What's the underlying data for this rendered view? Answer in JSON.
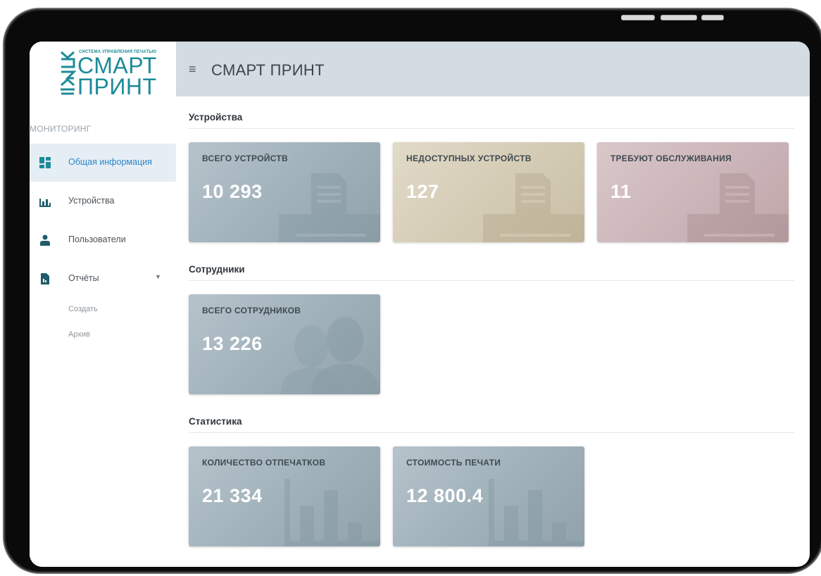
{
  "app": {
    "logo_tagline": "СИСТЕМА УПРАВЛЕНИЯ ПЕЧАТЬЮ",
    "logo_line1": "СМАРТ",
    "logo_line2": "ПРИНТ",
    "header_title": "СМАРТ ПРИНТ",
    "brand_color": "#1d8b98"
  },
  "sidebar": {
    "section_label": "МОНИТОРИНГ",
    "items": [
      {
        "label": "Общая информация",
        "icon": "dashboard-icon",
        "active": true
      },
      {
        "label": "Устройства",
        "icon": "bar-chart-icon",
        "active": false
      },
      {
        "label": "Пользователи",
        "icon": "user-icon",
        "active": false
      },
      {
        "label": "Отчёты",
        "icon": "document-icon",
        "active": false,
        "expandable": true
      }
    ],
    "sub_items": [
      {
        "label": "Создать"
      },
      {
        "label": "Архив"
      }
    ]
  },
  "groups": [
    {
      "title": "Устройства",
      "cards": [
        {
          "label": "ВСЕГО УСТРОЙСТВ",
          "value": "10 293",
          "color": "gray",
          "icon": "printer-icon"
        },
        {
          "label": "НЕДОСТУПНЫХ УСТРОЙСТВ",
          "value": "127",
          "color": "beige",
          "icon": "printer-icon"
        },
        {
          "label": "ТРЕБУЮТ ОБСЛУЖИВАНИЯ",
          "value": "11",
          "color": "rose",
          "icon": "printer-icon"
        }
      ]
    },
    {
      "title": "Сотрудники",
      "cards": [
        {
          "label": "ВСЕГО СОТРУДНИКОВ",
          "value": "13 226",
          "color": "gray",
          "icon": "people-icon"
        }
      ]
    },
    {
      "title": "Статистика",
      "cards": [
        {
          "label": "КОЛИЧЕСТВО ОТПЕЧАТКОВ",
          "value": "21 334",
          "color": "gray",
          "icon": "bar-chart-icon"
        },
        {
          "label": "СТОИМОСТЬ ПЕЧАТИ",
          "value": "12 800.4",
          "color": "gray",
          "icon": "bar-chart-icon"
        }
      ]
    }
  ]
}
